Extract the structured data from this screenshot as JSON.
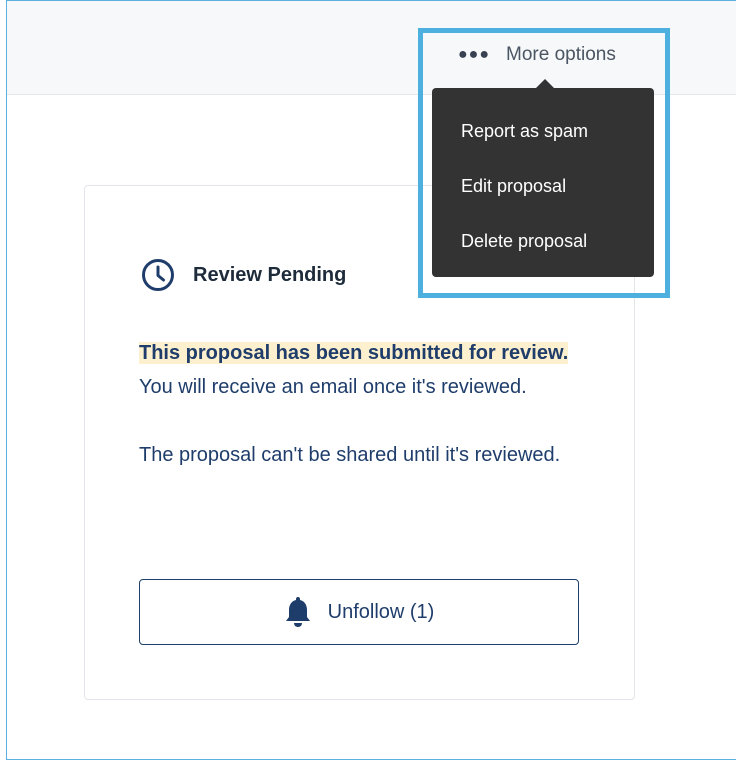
{
  "header": {
    "more_options_label": "More options",
    "more_options_icon": "ellipsis-icon"
  },
  "menu": {
    "items": [
      {
        "label": "Report as spam"
      },
      {
        "label": "Edit proposal"
      },
      {
        "label": "Delete proposal"
      }
    ]
  },
  "card": {
    "status_icon": "clock-icon",
    "status_title": "Review Pending",
    "message_highlight": "This proposal has been submitted for review.",
    "message_rest": " You will receive an email once it's reviewed.",
    "message_second": "The proposal can't be shared until it's reviewed.",
    "unfollow_icon": "bell-icon",
    "unfollow_label": "Unfollow (1)"
  },
  "colors": {
    "highlight_border": "#4eb0de",
    "menu_background": "#333333",
    "primary_text": "#1f3d6b",
    "highlight_background": "#fdf0cf"
  }
}
